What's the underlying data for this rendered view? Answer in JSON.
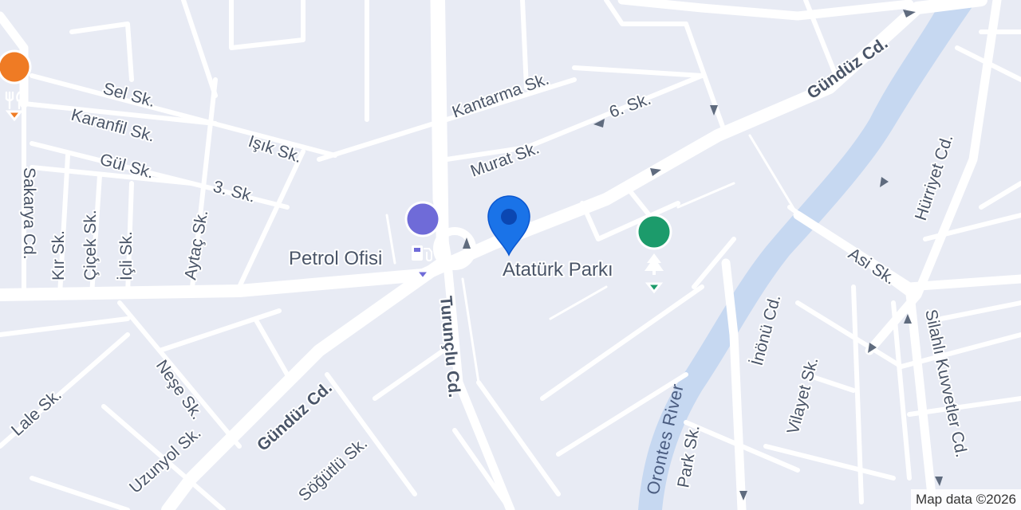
{
  "map": {
    "streets": {
      "sel": "Sel Sk.",
      "karanfil": "Karanfil Sk.",
      "isik": "Işık Sk.",
      "gul": "Gül Sk.",
      "uc": "3. Sk.",
      "kantarma": "Kantarma Sk.",
      "alti": "6. Sk.",
      "murat": "Murat Sk.",
      "gunduz_ne": "Gündüz Cd.",
      "gunduz_sw": "Gündüz Cd.",
      "sakarya": "Sakarya Cd.",
      "kir": "Kır Sk.",
      "cicek": "Çiçek Sk.",
      "icli": "İçli Sk.",
      "aytac": "Aytaç Sk.",
      "hurriyet": "Hürriyet Cd.",
      "asi": "Asi Sk.",
      "inonu": "İnönü Cd.",
      "vilayet": "Vilayet Sk.",
      "silahli": "Silahlı Kuvvetler Cd.",
      "park": "Park Sk.",
      "turunclu": "Turunçlu Cd.",
      "nese": "Neşe Sk.",
      "lale": "Lale Sk.",
      "uzunyol": "Uzunyol Sk.",
      "sogutlu": "Söğütlü Sk."
    },
    "water": {
      "river": "Orontes River"
    },
    "pois": [
      {
        "label": "Petrol Ofisi",
        "icon": "gas-station-icon",
        "color": "#6f6bd8"
      },
      {
        "label": "Atatürk Parkı",
        "icon": "tree-icon",
        "color": "#1c9b6b"
      },
      {
        "label": "",
        "icon": "restaurant-icon",
        "color": "#ef7b24"
      }
    ],
    "location_pin": {
      "icon": "location-pin-icon",
      "color": "#1a73e8"
    },
    "attribution": "Map data ©2026"
  }
}
